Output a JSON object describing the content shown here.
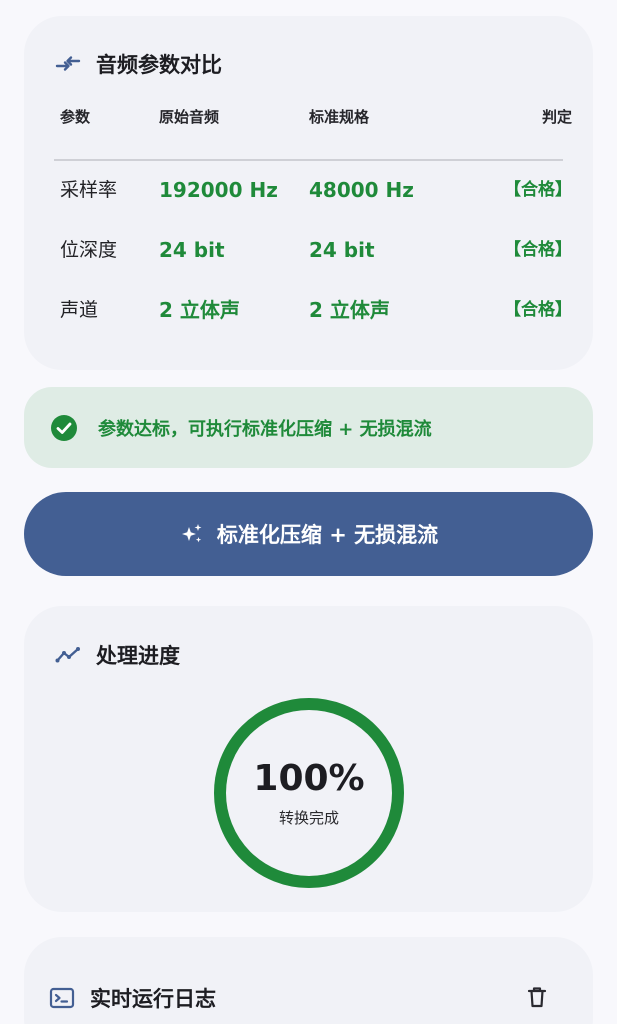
{
  "params": {
    "title": "音频参数对比",
    "headers": [
      "参数",
      "原始音频",
      "标准规格",
      "判定"
    ],
    "rows": [
      {
        "name": "采样率",
        "original": "192000 Hz",
        "standard": "48000 Hz",
        "verdict": "【合格】"
      },
      {
        "name": "位深度",
        "original": "24 bit",
        "standard": "24 bit",
        "verdict": "【合格】"
      },
      {
        "name": "声道",
        "original": "2 立体声",
        "standard": "2 立体声",
        "verdict": "【合格】"
      }
    ]
  },
  "banner": {
    "text": "参数达标，可执行标准化压缩 + 无损混流"
  },
  "action": {
    "label": "标准化压缩 + 无损混流"
  },
  "progress": {
    "title": "处理进度",
    "percent_text": "100%",
    "value": 1.0,
    "status": "转换完成"
  },
  "log": {
    "title": "实时运行日志"
  },
  "colors": {
    "accent": "#435f93",
    "success": "#1f8a3a",
    "card": "#f1f2f7",
    "banner": "#dfece5"
  },
  "icons": {
    "params": "compare-arrows-icon",
    "banner": "check-circle-icon",
    "action": "sparkle-icon",
    "progress": "trend-line-icon",
    "log": "terminal-icon",
    "clear": "trash-icon"
  }
}
